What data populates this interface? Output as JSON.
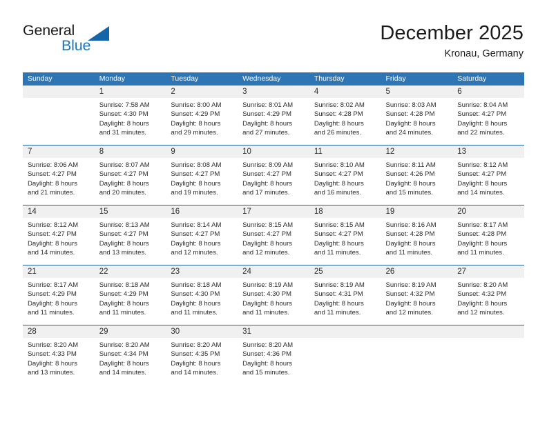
{
  "brand": {
    "word1": "General",
    "word2": "Blue",
    "flag_icon": "triangle-flag-icon",
    "color_dark": "#1b1b1b",
    "color_blue": "#1c75bc",
    "color_flag": "#1565a8"
  },
  "header": {
    "title": "December 2025",
    "subtitle": "Kronau, Germany"
  },
  "theme": {
    "header_bg": "#2e75b6",
    "header_text": "#ffffff",
    "daynum_band_bg": "#f0f0f0",
    "week_separator": "#1f5fa0",
    "cell_text": "#2b2b2b",
    "page_bg": "#ffffff"
  },
  "weekday_headers": [
    "Sunday",
    "Monday",
    "Tuesday",
    "Wednesday",
    "Thursday",
    "Friday",
    "Saturday"
  ],
  "weeks": [
    [
      {
        "empty": true
      },
      {
        "day": "1",
        "lines": [
          "Sunrise: 7:58 AM",
          "Sunset: 4:30 PM",
          "Daylight: 8 hours",
          "and 31 minutes."
        ]
      },
      {
        "day": "2",
        "lines": [
          "Sunrise: 8:00 AM",
          "Sunset: 4:29 PM",
          "Daylight: 8 hours",
          "and 29 minutes."
        ]
      },
      {
        "day": "3",
        "lines": [
          "Sunrise: 8:01 AM",
          "Sunset: 4:29 PM",
          "Daylight: 8 hours",
          "and 27 minutes."
        ]
      },
      {
        "day": "4",
        "lines": [
          "Sunrise: 8:02 AM",
          "Sunset: 4:28 PM",
          "Daylight: 8 hours",
          "and 26 minutes."
        ]
      },
      {
        "day": "5",
        "lines": [
          "Sunrise: 8:03 AM",
          "Sunset: 4:28 PM",
          "Daylight: 8 hours",
          "and 24 minutes."
        ]
      },
      {
        "day": "6",
        "lines": [
          "Sunrise: 8:04 AM",
          "Sunset: 4:27 PM",
          "Daylight: 8 hours",
          "and 22 minutes."
        ]
      }
    ],
    [
      {
        "day": "7",
        "lines": [
          "Sunrise: 8:06 AM",
          "Sunset: 4:27 PM",
          "Daylight: 8 hours",
          "and 21 minutes."
        ]
      },
      {
        "day": "8",
        "lines": [
          "Sunrise: 8:07 AM",
          "Sunset: 4:27 PM",
          "Daylight: 8 hours",
          "and 20 minutes."
        ]
      },
      {
        "day": "9",
        "lines": [
          "Sunrise: 8:08 AM",
          "Sunset: 4:27 PM",
          "Daylight: 8 hours",
          "and 19 minutes."
        ]
      },
      {
        "day": "10",
        "lines": [
          "Sunrise: 8:09 AM",
          "Sunset: 4:27 PM",
          "Daylight: 8 hours",
          "and 17 minutes."
        ]
      },
      {
        "day": "11",
        "lines": [
          "Sunrise: 8:10 AM",
          "Sunset: 4:27 PM",
          "Daylight: 8 hours",
          "and 16 minutes."
        ]
      },
      {
        "day": "12",
        "lines": [
          "Sunrise: 8:11 AM",
          "Sunset: 4:26 PM",
          "Daylight: 8 hours",
          "and 15 minutes."
        ]
      },
      {
        "day": "13",
        "lines": [
          "Sunrise: 8:12 AM",
          "Sunset: 4:27 PM",
          "Daylight: 8 hours",
          "and 14 minutes."
        ]
      }
    ],
    [
      {
        "day": "14",
        "lines": [
          "Sunrise: 8:12 AM",
          "Sunset: 4:27 PM",
          "Daylight: 8 hours",
          "and 14 minutes."
        ]
      },
      {
        "day": "15",
        "lines": [
          "Sunrise: 8:13 AM",
          "Sunset: 4:27 PM",
          "Daylight: 8 hours",
          "and 13 minutes."
        ]
      },
      {
        "day": "16",
        "lines": [
          "Sunrise: 8:14 AM",
          "Sunset: 4:27 PM",
          "Daylight: 8 hours",
          "and 12 minutes."
        ]
      },
      {
        "day": "17",
        "lines": [
          "Sunrise: 8:15 AM",
          "Sunset: 4:27 PM",
          "Daylight: 8 hours",
          "and 12 minutes."
        ]
      },
      {
        "day": "18",
        "lines": [
          "Sunrise: 8:15 AM",
          "Sunset: 4:27 PM",
          "Daylight: 8 hours",
          "and 11 minutes."
        ]
      },
      {
        "day": "19",
        "lines": [
          "Sunrise: 8:16 AM",
          "Sunset: 4:28 PM",
          "Daylight: 8 hours",
          "and 11 minutes."
        ]
      },
      {
        "day": "20",
        "lines": [
          "Sunrise: 8:17 AM",
          "Sunset: 4:28 PM",
          "Daylight: 8 hours",
          "and 11 minutes."
        ]
      }
    ],
    [
      {
        "day": "21",
        "lines": [
          "Sunrise: 8:17 AM",
          "Sunset: 4:29 PM",
          "Daylight: 8 hours",
          "and 11 minutes."
        ]
      },
      {
        "day": "22",
        "lines": [
          "Sunrise: 8:18 AM",
          "Sunset: 4:29 PM",
          "Daylight: 8 hours",
          "and 11 minutes."
        ]
      },
      {
        "day": "23",
        "lines": [
          "Sunrise: 8:18 AM",
          "Sunset: 4:30 PM",
          "Daylight: 8 hours",
          "and 11 minutes."
        ]
      },
      {
        "day": "24",
        "lines": [
          "Sunrise: 8:19 AM",
          "Sunset: 4:30 PM",
          "Daylight: 8 hours",
          "and 11 minutes."
        ]
      },
      {
        "day": "25",
        "lines": [
          "Sunrise: 8:19 AM",
          "Sunset: 4:31 PM",
          "Daylight: 8 hours",
          "and 11 minutes."
        ]
      },
      {
        "day": "26",
        "lines": [
          "Sunrise: 8:19 AM",
          "Sunset: 4:32 PM",
          "Daylight: 8 hours",
          "and 12 minutes."
        ]
      },
      {
        "day": "27",
        "lines": [
          "Sunrise: 8:20 AM",
          "Sunset: 4:32 PM",
          "Daylight: 8 hours",
          "and 12 minutes."
        ]
      }
    ],
    [
      {
        "day": "28",
        "lines": [
          "Sunrise: 8:20 AM",
          "Sunset: 4:33 PM",
          "Daylight: 8 hours",
          "and 13 minutes."
        ]
      },
      {
        "day": "29",
        "lines": [
          "Sunrise: 8:20 AM",
          "Sunset: 4:34 PM",
          "Daylight: 8 hours",
          "and 14 minutes."
        ]
      },
      {
        "day": "30",
        "lines": [
          "Sunrise: 8:20 AM",
          "Sunset: 4:35 PM",
          "Daylight: 8 hours",
          "and 14 minutes."
        ]
      },
      {
        "day": "31",
        "lines": [
          "Sunrise: 8:20 AM",
          "Sunset: 4:36 PM",
          "Daylight: 8 hours",
          "and 15 minutes."
        ]
      },
      {
        "empty": true
      },
      {
        "empty": true
      },
      {
        "empty": true
      }
    ]
  ]
}
